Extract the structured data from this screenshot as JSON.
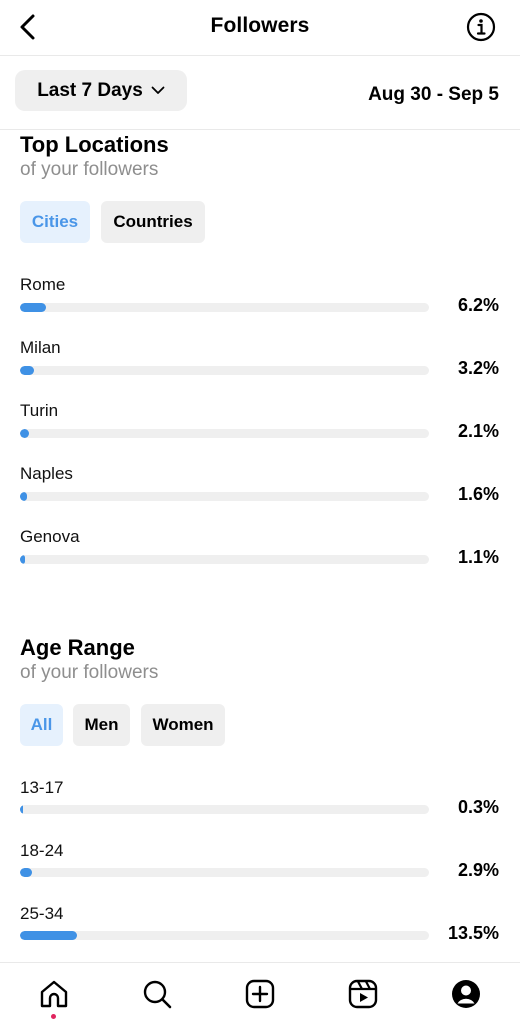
{
  "header": {
    "title": "Followers",
    "back_icon": "chevron-left-icon",
    "info_icon": "info-icon"
  },
  "date_filter": {
    "period_label": "Last 7 Days",
    "range": "Aug 30 - Sep 5"
  },
  "top_locations": {
    "title": "Top Locations",
    "subtitle": "of your followers",
    "tabs": [
      {
        "label": "Cities",
        "active": true
      },
      {
        "label": "Countries",
        "active": false
      }
    ],
    "rows": [
      {
        "label": "Rome",
        "value": "6.2%",
        "percent": 6.2
      },
      {
        "label": "Milan",
        "value": "3.2%",
        "percent": 3.2
      },
      {
        "label": "Turin",
        "value": "2.1%",
        "percent": 2.1
      },
      {
        "label": "Naples",
        "value": "1.6%",
        "percent": 1.6
      },
      {
        "label": "Genova",
        "value": "1.1%",
        "percent": 1.1
      }
    ]
  },
  "age_range": {
    "title": "Age Range",
    "subtitle": "of your followers",
    "tabs": [
      {
        "label": "All",
        "active": true
      },
      {
        "label": "Men",
        "active": false
      },
      {
        "label": "Women",
        "active": false
      }
    ],
    "rows": [
      {
        "label": "13-17",
        "value": "0.3%",
        "percent": 0.3
      },
      {
        "label": "18-24",
        "value": "2.9%",
        "percent": 2.9
      },
      {
        "label": "25-34",
        "value": "13.5%",
        "percent": 13.5
      }
    ]
  },
  "bottom_nav": [
    {
      "name": "home",
      "icon": "home-icon",
      "active": true
    },
    {
      "name": "search",
      "icon": "search-icon",
      "active": false
    },
    {
      "name": "create",
      "icon": "add-post-icon",
      "active": false
    },
    {
      "name": "reels",
      "icon": "reels-icon",
      "active": false
    },
    {
      "name": "profile",
      "icon": "profile-icon",
      "active": false
    }
  ],
  "colors": {
    "accent": "#3f91e5",
    "active_tab_bg": "#e6f1fd",
    "active_tab_text": "#4a96e8",
    "track": "#efefef",
    "notification_dot": "#e0245e"
  }
}
